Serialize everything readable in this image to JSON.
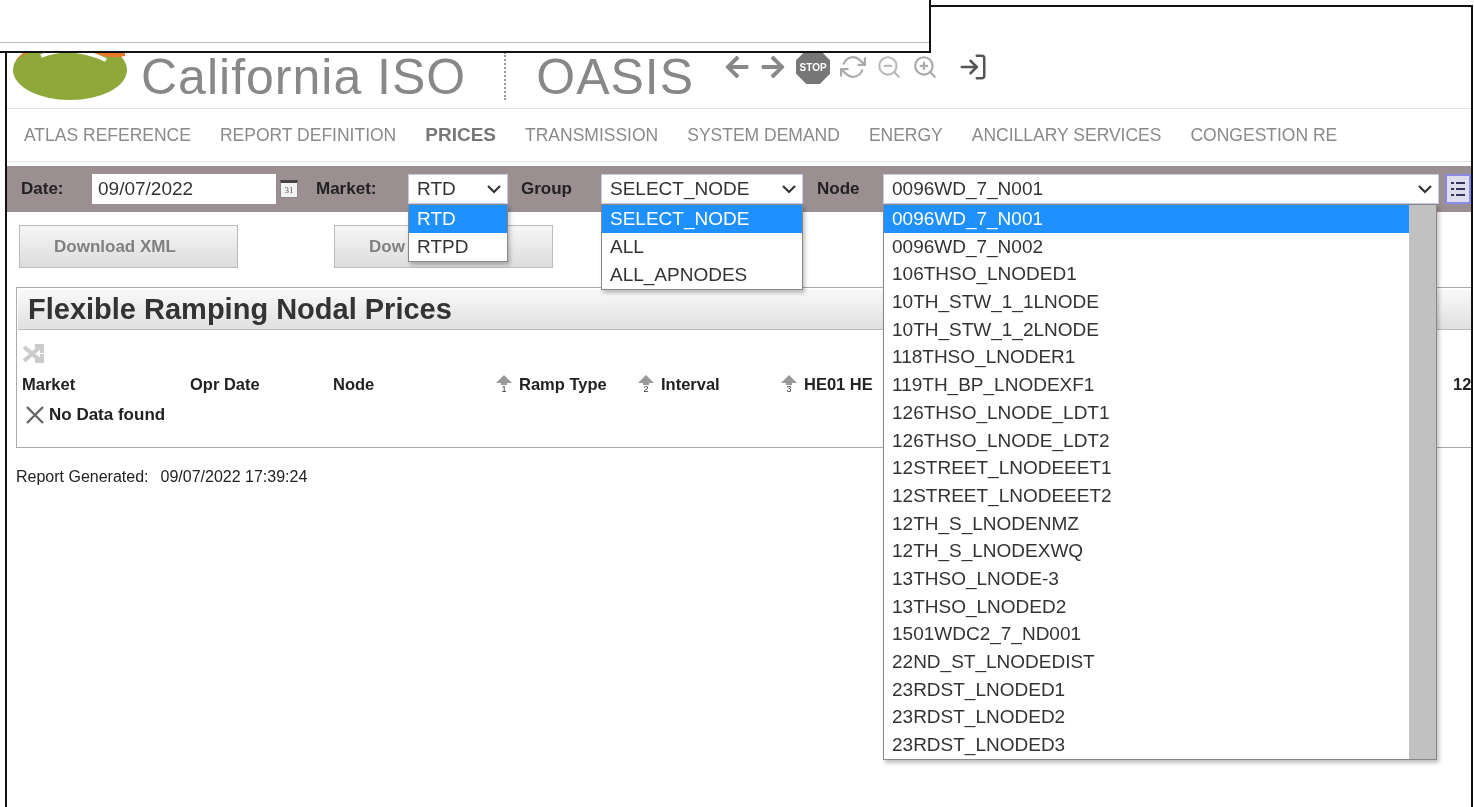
{
  "header": {
    "logo_text": "California ISO",
    "app_name": "OASIS",
    "stop_label": "STOP"
  },
  "nav": [
    {
      "label": "ATLAS REFERENCE",
      "selected": false
    },
    {
      "label": "REPORT DEFINITION",
      "selected": false
    },
    {
      "label": "PRICES",
      "selected": true
    },
    {
      "label": "TRANSMISSION",
      "selected": false
    },
    {
      "label": "SYSTEM DEMAND",
      "selected": false
    },
    {
      "label": "ENERGY",
      "selected": false
    },
    {
      "label": "ANCILLARY SERVICES",
      "selected": false
    },
    {
      "label": "CONGESTION RE",
      "selected": false
    }
  ],
  "filters": {
    "date": {
      "label": "Date:",
      "value": "09/07/2022",
      "calendar_label": "31"
    },
    "market": {
      "label": "Market:",
      "value": "RTD",
      "options": [
        {
          "label": "RTD",
          "selected": true
        },
        {
          "label": "RTPD",
          "selected": false
        }
      ]
    },
    "group": {
      "label": "Group",
      "value": "SELECT_NODE",
      "options": [
        {
          "label": "SELECT_NODE",
          "selected": true
        },
        {
          "label": "ALL",
          "selected": false
        },
        {
          "label": "ALL_APNODES",
          "selected": false
        }
      ]
    },
    "node": {
      "label": "Node",
      "value": "0096WD_7_N001",
      "options": [
        {
          "label": "0096WD_7_N001",
          "selected": true
        },
        {
          "label": "0096WD_7_N002",
          "selected": false
        },
        {
          "label": "106THSO_LNODED1",
          "selected": false
        },
        {
          "label": "10TH_STW_1_1LNODE",
          "selected": false
        },
        {
          "label": "10TH_STW_1_2LNODE",
          "selected": false
        },
        {
          "label": "118THSO_LNODER1",
          "selected": false
        },
        {
          "label": "119TH_BP_LNODEXF1",
          "selected": false
        },
        {
          "label": "126THSO_LNODE_LDT1",
          "selected": false
        },
        {
          "label": "126THSO_LNODE_LDT2",
          "selected": false
        },
        {
          "label": "12STREET_LNODEEET1",
          "selected": false
        },
        {
          "label": "12STREET_LNODEEET2",
          "selected": false
        },
        {
          "label": "12TH_S_LNODENMZ",
          "selected": false
        },
        {
          "label": "12TH_S_LNODEXWQ",
          "selected": false
        },
        {
          "label": "13THSO_LNODE-3",
          "selected": false
        },
        {
          "label": "13THSO_LNODED2",
          "selected": false
        },
        {
          "label": "1501WDC2_7_ND001",
          "selected": false
        },
        {
          "label": "22ND_ST_LNODEDIST",
          "selected": false
        },
        {
          "label": "23RDST_LNODED1",
          "selected": false
        },
        {
          "label": "23RDST_LNODED2",
          "selected": false
        },
        {
          "label": "23RDST_LNODED3",
          "selected": false
        }
      ]
    }
  },
  "buttons": [
    "Download XML",
    "Dow"
  ],
  "panel": {
    "title": "Flexible Ramping Nodal Prices",
    "columns": [
      {
        "label": "Market"
      },
      {
        "label": "Opr Date"
      },
      {
        "label": "Node"
      },
      {
        "label": "Ramp Type",
        "sort": "1"
      },
      {
        "label": "Interval",
        "sort": "2"
      },
      {
        "label": "HE01 HE",
        "sort": "3"
      },
      {
        "label": "12"
      }
    ],
    "empty_message": "No Data found"
  },
  "report_generated": {
    "label": "Report Generated:",
    "value": "09/07/2022 17:39:24"
  }
}
